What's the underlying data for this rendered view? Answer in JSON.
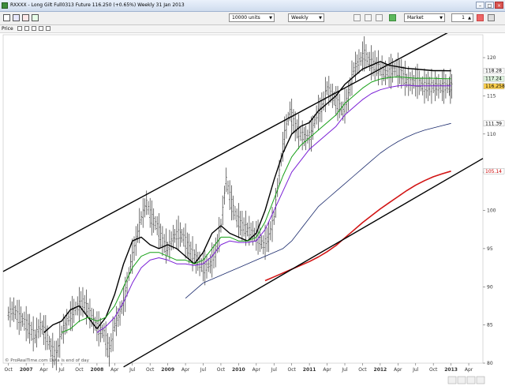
{
  "window": {
    "title": "RXXXX - Long Gilt Full0313 Future 116.250 (+0.65%) Weekly 31 Jan 2013"
  },
  "toolbar": {
    "units_value": "10000 units",
    "period_value": "Weekly",
    "order_type_value": "Market",
    "quantity_value": "1"
  },
  "infobar": {
    "price_label": "Price"
  },
  "watermark": "© ProRealTime.com Data is end of day",
  "price_tags": [
    {
      "value": 118.28,
      "label": "118.28",
      "color": "#000000",
      "bg": "#ffffff"
    },
    {
      "value": 117.24,
      "label": "117.24",
      "color": "#000000",
      "bg": "#dff5df"
    },
    {
      "value": 116.258,
      "label": "116.258",
      "color": "#000000",
      "bg": "#ffd24d"
    },
    {
      "value": 111.39,
      "label": "111.39",
      "color": "#000000",
      "bg": "#ffffff"
    },
    {
      "value": 105.14,
      "label": "105.14",
      "color": "#cc0000",
      "bg": "#ffffff"
    }
  ],
  "chart_data": {
    "type": "line",
    "title": "",
    "xlabel": "",
    "ylabel": "",
    "ylim": [
      80,
      123
    ],
    "y_ticks": [
      80,
      85,
      90,
      95,
      100,
      105,
      110,
      115,
      120
    ],
    "x_ticks": [
      "Oct",
      "2007",
      "Apr",
      "Jul",
      "Oct",
      "2008",
      "Apr",
      "Jul",
      "Oct",
      "2009",
      "Apr",
      "Jul",
      "Oct",
      "2010",
      "Apr",
      "Jul",
      "Oct",
      "2011",
      "Apr",
      "Jul",
      "Oct",
      "2012",
      "Apr",
      "Jul",
      "Oct",
      "2013",
      "Apr"
    ],
    "x_tick_pos": [
      0,
      1,
      2,
      3,
      4,
      5,
      6,
      7,
      8,
      9,
      10,
      11,
      12,
      13,
      14,
      15,
      16,
      17,
      18,
      19,
      20,
      21,
      22,
      23,
      24,
      25,
      26
    ],
    "grid": false,
    "series": [
      {
        "key": "price",
        "color": "#333333",
        "x": [
          0,
          0.3,
          0.6,
          0.9,
          1.2,
          1.5,
          1.8,
          2.1,
          2.4,
          2.7,
          3.0,
          3.3,
          3.6,
          3.9,
          4.2,
          4.5,
          4.8,
          5.1,
          5.4,
          5.7,
          6.0,
          6.3,
          6.6,
          6.9,
          7.2,
          7.5,
          7.8,
          8.1,
          8.4,
          8.7,
          9.0,
          9.3,
          9.6,
          9.9,
          10.2,
          10.5,
          10.8,
          11.1,
          11.4,
          11.7,
          12.0,
          12.3,
          12.6,
          12.9,
          13.2,
          13.5,
          13.8,
          14.1,
          14.4,
          14.7,
          15.0,
          15.3,
          15.6,
          15.9,
          16.2,
          16.5,
          16.8,
          17.1,
          17.4,
          17.7,
          18.0,
          18.3,
          18.6,
          18.9,
          19.2,
          19.5,
          19.8,
          20.1,
          20.4,
          20.7,
          21.0,
          21.3,
          21.6,
          21.9,
          22.2,
          22.5,
          22.8,
          23.1,
          23.4,
          23.7,
          24.0,
          24.3,
          24.6,
          24.9,
          25.1
        ],
        "values": [
          86.5,
          87.0,
          86.0,
          85.5,
          84.5,
          83.5,
          85.0,
          84.0,
          82.0,
          81.0,
          84.0,
          85.5,
          86.5,
          87.5,
          88.0,
          87.0,
          85.5,
          84.5,
          84.0,
          81.5,
          85.0,
          86.5,
          89.0,
          93.0,
          96.0,
          99.0,
          101.0,
          99.0,
          98.0,
          96.0,
          95.0,
          96.5,
          97.0,
          96.5,
          95.0,
          94.0,
          93.0,
          92.5,
          93.0,
          94.5,
          98.0,
          104.0,
          101.0,
          99.0,
          98.0,
          97.5,
          97.0,
          96.5,
          95.5,
          96.5,
          99.0,
          105.0,
          110.0,
          113.0,
          111.0,
          110.0,
          109.5,
          110.0,
          112.5,
          113.5,
          116.0,
          115.0,
          114.0,
          113.0,
          115.0,
          118.5,
          119.5,
          120.5,
          119.5,
          119.0,
          118.5,
          118.0,
          118.2,
          118.6,
          117.9,
          117.0,
          116.8,
          116.9,
          116.3,
          116.25,
          116.25,
          116.25,
          116.25,
          116.25,
          116.25
        ],
        "name": ""
      },
      {
        "key": "ma_black",
        "color": "#000000",
        "x": [
          2.0,
          2.5,
          3.0,
          3.5,
          4.0,
          4.5,
          5.0,
          5.5,
          6.0,
          6.5,
          7.0,
          7.5,
          8.0,
          8.5,
          9.0,
          9.5,
          10.0,
          10.5,
          11.0,
          11.5,
          12.0,
          12.5,
          13.0,
          13.5,
          14.0,
          14.5,
          15.0,
          15.5,
          16.0,
          16.5,
          17.0,
          17.5,
          18.0,
          18.5,
          19.0,
          19.5,
          20.0,
          20.5,
          21.0,
          21.5,
          22.0,
          22.5,
          23.0,
          23.5,
          24.0,
          24.5,
          25.0
        ],
        "values": [
          84.0,
          85.0,
          85.5,
          87.0,
          87.5,
          86.0,
          84.5,
          86.0,
          89.0,
          93.0,
          96.0,
          96.5,
          95.5,
          95.0,
          95.5,
          95.0,
          94.0,
          93.0,
          94.5,
          97.0,
          98.0,
          97.0,
          96.5,
          96.0,
          97.0,
          100.0,
          104.0,
          107.5,
          110.0,
          111.0,
          111.5,
          113.0,
          114.0,
          115.0,
          116.5,
          117.5,
          118.5,
          119.0,
          119.5,
          119.0,
          118.8,
          118.6,
          118.5,
          118.4,
          118.3,
          118.3,
          118.28
        ],
        "name": ""
      },
      {
        "key": "ma_green",
        "color": "#16a016",
        "x": [
          3.0,
          3.5,
          4.0,
          4.5,
          5.0,
          5.5,
          6.0,
          6.5,
          7.0,
          7.5,
          8.0,
          8.5,
          9.0,
          9.5,
          10.0,
          10.5,
          11.0,
          11.5,
          12.0,
          12.5,
          13.0,
          13.5,
          14.0,
          14.5,
          15.0,
          15.5,
          16.0,
          16.5,
          17.0,
          17.5,
          18.0,
          18.5,
          19.0,
          19.5,
          20.0,
          20.5,
          21.0,
          21.5,
          22.0,
          22.5,
          23.0,
          23.5,
          24.0,
          24.5,
          25.0
        ],
        "values": [
          84.0,
          84.5,
          85.5,
          86.0,
          85.5,
          86.0,
          87.5,
          90.0,
          92.5,
          94.0,
          94.5,
          94.5,
          94.0,
          93.5,
          93.5,
          93.0,
          93.5,
          95.0,
          96.5,
          96.5,
          96.0,
          96.0,
          96.5,
          98.5,
          101.5,
          104.5,
          107.0,
          108.5,
          109.5,
          110.5,
          111.5,
          112.5,
          114.0,
          115.0,
          116.0,
          116.8,
          117.2,
          117.4,
          117.5,
          117.4,
          117.3,
          117.3,
          117.3,
          117.25,
          117.24
        ],
        "name": ""
      },
      {
        "key": "ma_purple",
        "color": "#7a1fd6",
        "x": [
          5.0,
          5.5,
          6.0,
          6.5,
          7.0,
          7.5,
          8.0,
          8.5,
          9.0,
          9.5,
          10.0,
          10.5,
          11.0,
          11.5,
          12.0,
          12.5,
          13.0,
          13.5,
          14.0,
          14.5,
          15.0,
          15.5,
          16.0,
          16.5,
          17.0,
          17.5,
          18.0,
          18.5,
          19.0,
          19.5,
          20.0,
          20.5,
          21.0,
          21.5,
          22.0,
          22.5,
          23.0,
          23.5,
          24.0,
          24.5,
          25.0
        ],
        "values": [
          84.0,
          84.8,
          86.0,
          88.0,
          90.5,
          92.5,
          93.5,
          93.8,
          93.5,
          93.0,
          93.0,
          92.8,
          93.0,
          94.0,
          95.5,
          96.0,
          95.8,
          95.8,
          96.0,
          97.5,
          100.0,
          102.5,
          105.0,
          106.5,
          108.0,
          109.0,
          110.0,
          111.0,
          112.5,
          113.5,
          114.5,
          115.3,
          115.8,
          116.1,
          116.3,
          116.4,
          116.3,
          116.3,
          116.3,
          116.3,
          116.3
        ],
        "name": ""
      },
      {
        "key": "ma_navy",
        "color": "#1a2a6c",
        "x": [
          10.0,
          10.5,
          11.0,
          11.5,
          12.0,
          12.5,
          13.0,
          13.5,
          14.0,
          14.5,
          15.0,
          15.5,
          16.0,
          16.5,
          17.0,
          17.5,
          18.0,
          18.5,
          19.0,
          19.5,
          20.0,
          20.5,
          21.0,
          21.5,
          22.0,
          22.5,
          23.0,
          23.5,
          24.0,
          24.5,
          25.0
        ],
        "values": [
          88.5,
          89.5,
          90.5,
          91.0,
          91.5,
          92.0,
          92.5,
          93.0,
          93.5,
          94.0,
          94.5,
          95.0,
          96.0,
          97.5,
          99.0,
          100.5,
          101.5,
          102.5,
          103.5,
          104.5,
          105.5,
          106.5,
          107.5,
          108.3,
          109.0,
          109.6,
          110.1,
          110.5,
          110.8,
          111.1,
          111.39
        ],
        "name": ""
      },
      {
        "key": "ma_red",
        "color": "#d21414",
        "x": [
          14.5,
          15.0,
          15.5,
          16.0,
          16.5,
          17.0,
          17.5,
          18.0,
          18.5,
          19.0,
          19.5,
          20.0,
          20.5,
          21.0,
          21.5,
          22.0,
          22.5,
          23.0,
          23.5,
          24.0,
          24.5,
          25.0
        ],
        "values": [
          90.8,
          91.3,
          91.8,
          92.3,
          92.8,
          93.3,
          93.9,
          94.6,
          95.4,
          96.4,
          97.4,
          98.4,
          99.3,
          100.2,
          101.0,
          101.8,
          102.6,
          103.3,
          103.9,
          104.4,
          104.8,
          105.14
        ],
        "name": ""
      },
      {
        "key": "channel_upper",
        "color": "#000000",
        "x": [
          -0.3,
          25.4
        ],
        "values": [
          92.0,
          124.0
        ],
        "name": ""
      },
      {
        "key": "channel_lower",
        "color": "#000000",
        "x": [
          6.5,
          26.8
        ],
        "values": [
          79.5,
          106.8
        ],
        "name": ""
      }
    ]
  }
}
